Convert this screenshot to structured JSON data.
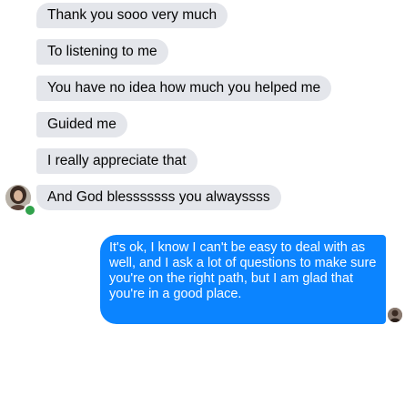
{
  "conversation": {
    "received_messages": [
      "Thank you sooo very much",
      "To listening to me",
      "You have no idea how much you helped me",
      "Guided me",
      "I really appreciate that",
      "And God blesssssss you alwayssss"
    ],
    "sent_message": {
      "lines": [
        "It's ok, I know I can't be easy to deal with as",
        "well, and I ask a lot of questions to make sure",
        "you're on the right path, but I am glad that",
        "you're in a good place."
      ]
    },
    "contact_online": true
  },
  "colors": {
    "received_bubble": "#e4e6eb",
    "sent_bubble": "#0b84ff",
    "presence_dot": "#31a24c"
  },
  "icons": {
    "avatar": "contact-avatar-icon",
    "read_receipt": "read-receipt-avatar-icon"
  }
}
